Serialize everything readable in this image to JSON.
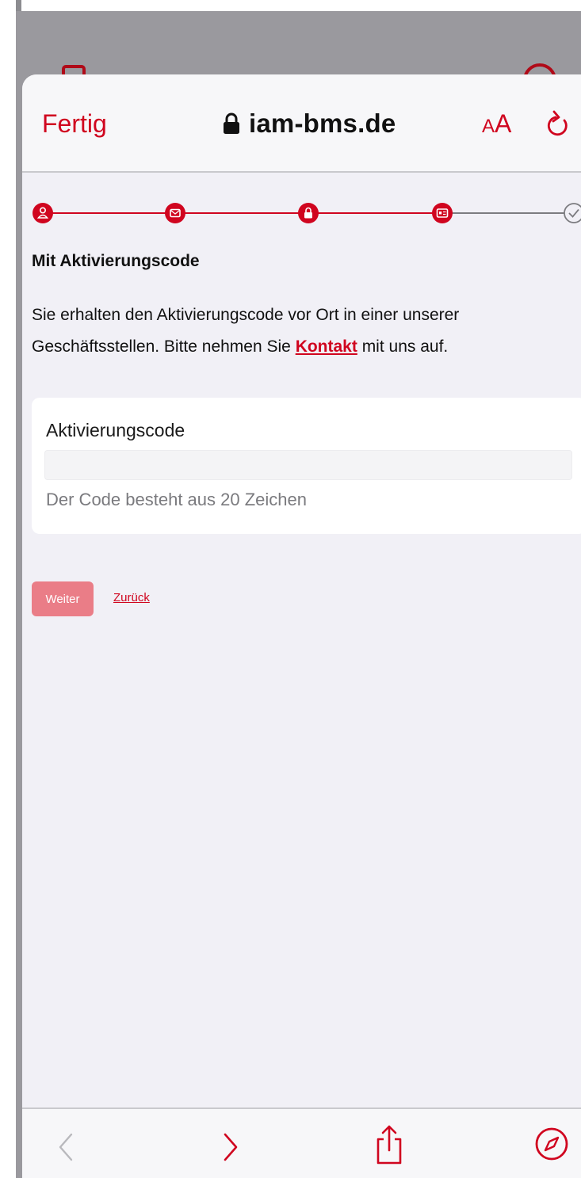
{
  "browser": {
    "done_label": "Fertig",
    "url": "iam-bms.de",
    "text_size_small": "A",
    "text_size_large": "A"
  },
  "stepper": {
    "steps": [
      {
        "icon": "user-icon",
        "state": "done"
      },
      {
        "icon": "mail-icon",
        "state": "done"
      },
      {
        "icon": "lock-icon",
        "state": "current"
      },
      {
        "icon": "id-card-icon",
        "state": "done"
      },
      {
        "icon": "check-icon",
        "state": "pending"
      }
    ]
  },
  "content": {
    "title": "Mit Aktivierungscode",
    "desc_line1": "Sie erhalten den Aktivierungscode vor Ort in einer unserer",
    "desc_line2_before": "Geschäftsstellen. Bitte nehmen Sie ",
    "desc_link": "Kontakt",
    "desc_line2_after": " mit uns auf."
  },
  "form": {
    "field_label": "Aktivierungscode",
    "field_value": "",
    "field_hint": "Der Code besteht aus 20 Zeichen"
  },
  "actions": {
    "next_label": "Weiter",
    "back_label": "Zurück"
  },
  "toolbar": {
    "icons": [
      "back-arrow-icon",
      "forward-arrow-icon",
      "share-icon",
      "compass-icon"
    ]
  },
  "colors": {
    "accent": "#d0051f",
    "button_disabled": "#ea7d87",
    "background": "#f1f0f6"
  }
}
